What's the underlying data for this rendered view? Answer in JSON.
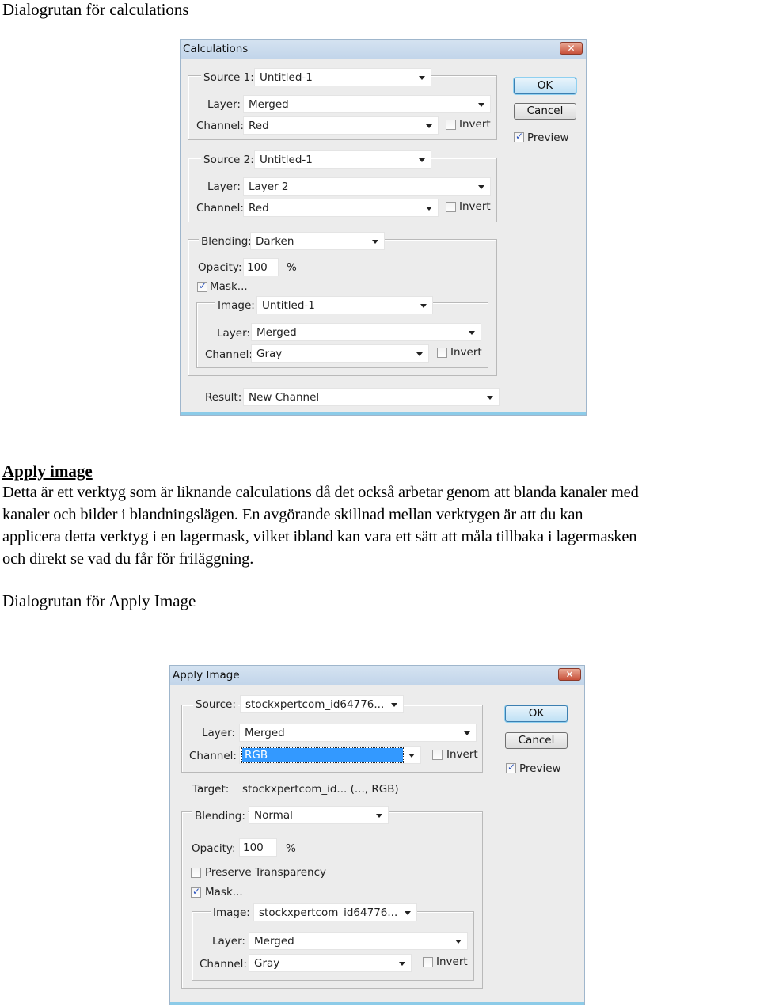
{
  "document": {
    "caption_calculations": "Dialogrutan för calculations",
    "heading": "Apply image",
    "paragraph_lines": [
      "Detta är ett verktyg som är liknande calculations då det också arbetar genom att blanda kanaler med",
      "kanaler och bilder i blandningslägen. En avgörande skillnad mellan verktygen är att du kan",
      "applicera detta verktyg i en lagermask, vilket ibland kan vara ett sätt att måla tillbaka i lagermasken",
      "och direkt se vad du får för friläggning."
    ],
    "caption_apply_image": "Dialogrutan för Apply Image"
  },
  "calculations_dialog": {
    "title": "Calculations",
    "close_icon": "close-icon",
    "source1": {
      "label": "Source 1:",
      "value": "Untitled-1",
      "layer_label": "Layer:",
      "layer": "Merged",
      "channel_label": "Channel:",
      "channel": "Red",
      "invert_label": "Invert",
      "invert": false
    },
    "source2": {
      "label": "Source 2:",
      "value": "Untitled-1",
      "layer_label": "Layer:",
      "layer": "Layer 2",
      "channel_label": "Channel:",
      "channel": "Red",
      "invert_label": "Invert",
      "invert": false
    },
    "blending": {
      "label": "Blending:",
      "value": "Darken",
      "opacity_label": "Opacity:",
      "opacity": "100",
      "percent": "%",
      "mask_label": "Mask...",
      "mask": true
    },
    "mask": {
      "image_label": "Image:",
      "image": "Untitled-1",
      "layer_label": "Layer:",
      "layer": "Merged",
      "channel_label": "Channel:",
      "channel": "Gray",
      "invert_label": "Invert",
      "invert": false
    },
    "result": {
      "label": "Result:",
      "value": "New Channel"
    },
    "buttons": {
      "ok": "OK",
      "cancel": "Cancel"
    },
    "preview_label": "Preview",
    "preview": true
  },
  "apply_image_dialog": {
    "title": "Apply Image",
    "source": {
      "label": "Source:",
      "value": "stockxpertcom_id64776...",
      "layer_label": "Layer:",
      "layer": "Merged",
      "channel_label": "Channel:",
      "channel": "RGB",
      "invert_label": "Invert",
      "invert": false
    },
    "target": {
      "label": "Target:",
      "value": "stockxpertcom_id... (..., RGB)"
    },
    "blending": {
      "label": "Blending:",
      "value": "Normal",
      "opacity_label": "Opacity:",
      "opacity": "100",
      "percent": "%",
      "preserve_label": "Preserve Transparency",
      "preserve": false,
      "mask_label": "Mask...",
      "mask": true
    },
    "mask": {
      "image_label": "Image:",
      "image": "stockxpertcom_id64776...",
      "layer_label": "Layer:",
      "layer": "Merged",
      "channel_label": "Channel:",
      "channel": "Gray",
      "invert_label": "Invert",
      "invert": false
    },
    "buttons": {
      "ok": "OK",
      "cancel": "Cancel"
    },
    "preview_label": "Preview",
    "preview": true
  },
  "colors": {
    "dialog_bg": "#ececec",
    "title_bg": "#c8d9ec",
    "close_red": "#c8513a",
    "highlight": "#3399ff",
    "accent_line": "#8ccbe8"
  }
}
